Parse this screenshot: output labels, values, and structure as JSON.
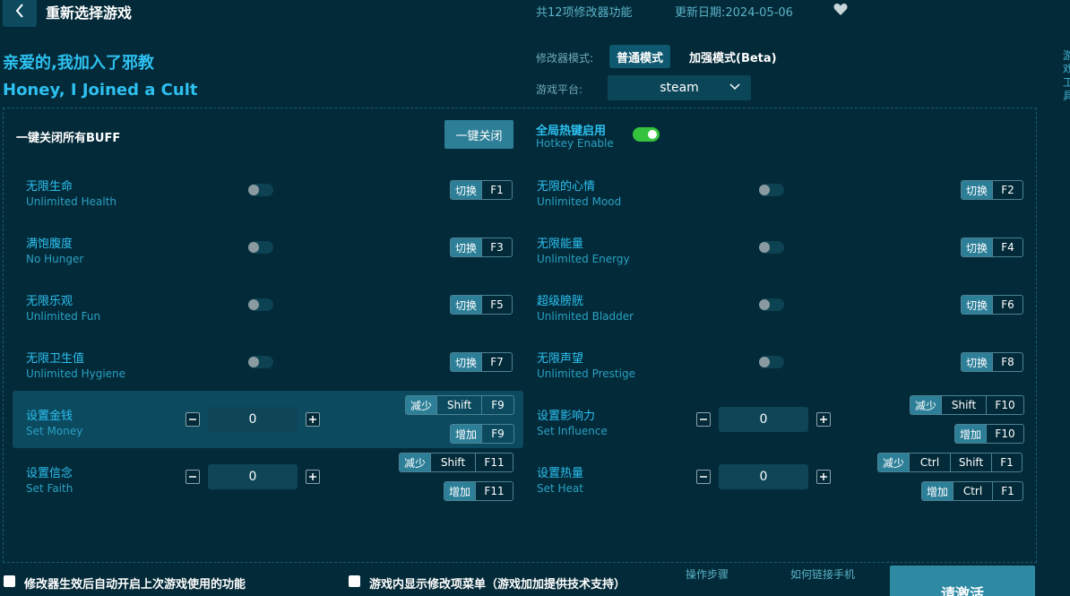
{
  "header": {
    "title": "重新选择游戏",
    "feature_count": "共12项修改器功能",
    "update_date": "更新日期:2024-05-06"
  },
  "side_text": "游戏工具",
  "game": {
    "name_cn": "亲爱的,我加入了邪教",
    "name_en": "Honey, I Joined a Cult"
  },
  "mode": {
    "label": "修改器模式:",
    "normal": "普通模式",
    "enhanced": "加强模式(Beta)"
  },
  "platform": {
    "label": "游戏平台:",
    "value": "steam"
  },
  "global": {
    "close_all_label": "一键关闭所有BUFF",
    "close_all_button": "一键关闭",
    "hotkey_cn": "全局热键启用",
    "hotkey_en": "Hotkey Enable"
  },
  "hotkey_words": {
    "toggle": "切换",
    "decrease": "减少",
    "increase": "增加"
  },
  "cheats_left": [
    {
      "cn": "无限生命",
      "en": "Unlimited Health",
      "key": "F1"
    },
    {
      "cn": "满饱腹度",
      "en": "No Hunger",
      "key": "F3"
    },
    {
      "cn": "无限乐观",
      "en": "Unlimited Fun",
      "key": "F5"
    },
    {
      "cn": "无限卫生值",
      "en": "Unlimited Hygiene",
      "key": "F7"
    }
  ],
  "cheats_right": [
    {
      "cn": "无限的心情",
      "en": "Unlimited Mood",
      "key": "F2"
    },
    {
      "cn": "无限能量",
      "en": "Unlimited Energy",
      "key": "F4"
    },
    {
      "cn": "超级膀胱",
      "en": "Unlimited Bladder",
      "key": "F6"
    },
    {
      "cn": "无限声望",
      "en": "Unlimited Prestige",
      "key": "F8"
    }
  ],
  "setters": {
    "money": {
      "cn": "设置金钱",
      "en": "Set Money",
      "value": "0",
      "dec_keys": [
        "Shift",
        "F9"
      ],
      "inc_keys": [
        "F9"
      ]
    },
    "influence": {
      "cn": "设置影响力",
      "en": "Set Influence",
      "value": "0",
      "dec_keys": [
        "Shift",
        "F10"
      ],
      "inc_keys": [
        "F10"
      ]
    },
    "faith": {
      "cn": "设置信念",
      "en": "Set Faith",
      "value": "0",
      "dec_keys": [
        "Shift",
        "F11"
      ],
      "inc_keys": [
        "F11"
      ]
    },
    "heat": {
      "cn": "设置热量",
      "en": "Set Heat",
      "value": "0",
      "dec_keys": [
        "Ctrl",
        "Shift",
        "F1"
      ],
      "inc_keys": [
        "Ctrl",
        "F1"
      ]
    }
  },
  "footer": {
    "auto_enable": "修改器生效后自动开启上次游戏使用的功能",
    "ingame_menu": "游戏内显示修改项菜单（游戏加加提供技术支持）",
    "steps_link": "操作步骤",
    "phone_link": "如何链接手机",
    "activate_button": "请激活"
  },
  "colors": {
    "background": "#032a38",
    "accent": "#2dc0f0",
    "toggle_on": "#35c33e",
    "button": "#2d7f98"
  }
}
